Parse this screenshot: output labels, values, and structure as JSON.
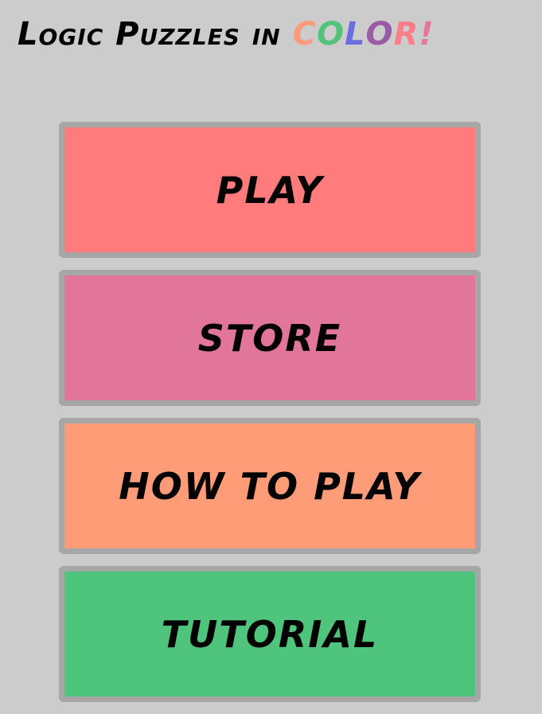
{
  "title": {
    "prefix": "Logic Puzzles in ",
    "color_letters": [
      {
        "char": "C",
        "color": "#ff9b7a"
      },
      {
        "char": "O",
        "color": "#52c47a"
      },
      {
        "char": "L",
        "color": "#6a6ee0"
      },
      {
        "char": "O",
        "color": "#9a5aa6"
      },
      {
        "char": "R",
        "color": "#ff7e8a"
      },
      {
        "char": "!",
        "color": "#e5779d"
      }
    ]
  },
  "menu": {
    "items": [
      {
        "label": "PLAY",
        "color": "#ff7b7c"
      },
      {
        "label": "STORE",
        "color": "#e2769a"
      },
      {
        "label": "HOW TO PLAY",
        "color": "#ff9c78"
      },
      {
        "label": "TUTORIAL",
        "color": "#4fc47c"
      }
    ]
  }
}
